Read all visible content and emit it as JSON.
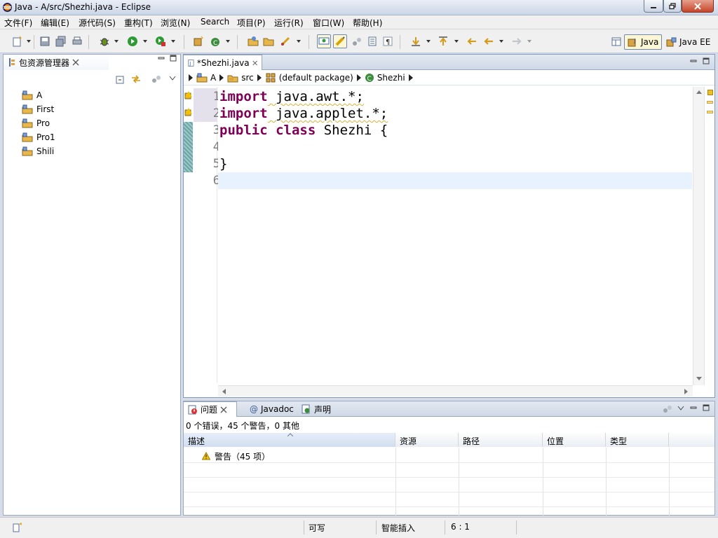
{
  "window": {
    "title": "Java  -  A/src/Shezhi.java  -  Eclipse"
  },
  "menu": [
    "文件(F)",
    "编辑(E)",
    "源代码(S)",
    "重构(T)",
    "浏览(N)",
    "Search",
    "项目(P)",
    "运行(R)",
    "窗口(W)",
    "帮助(H)"
  ],
  "perspectives": {
    "java": "Java",
    "javaee": "Java EE"
  },
  "explorer": {
    "title": "包资源管理器",
    "projects": [
      "A",
      "First",
      "Pro",
      "Pro1",
      "Shili"
    ]
  },
  "editor": {
    "tab": "*Shezhi.java",
    "breadcrumb": [
      "A",
      "src",
      "(default package)",
      "Shezhi"
    ],
    "line_numbers": [
      "1",
      "2",
      "3",
      "4",
      "5",
      "6"
    ],
    "code": {
      "l1_kw": "import",
      "l1_rest": " java.awt.*;",
      "l2_kw": "import",
      "l2_rest": " java.applet.*;",
      "l3_kw1": "public",
      "l3_kw2": "class",
      "l3_rest": " Shezhi {",
      "l5": "}"
    }
  },
  "problems": {
    "tabs": [
      "问题",
      "Javadoc",
      "声明"
    ],
    "summary": "0 个错误，45 个警告，0 其他",
    "columns": [
      "描述",
      "资源",
      "路径",
      "位置",
      "类型"
    ],
    "rows": [
      {
        "description": "警告（45 项）"
      }
    ]
  },
  "status": {
    "writable": "可写",
    "insert_mode": "智能插入",
    "position": "6 : 1"
  },
  "colors": {
    "keyword": "#7f0055",
    "current_line": "#e8f2fe",
    "chrome": "#d6dde8"
  }
}
